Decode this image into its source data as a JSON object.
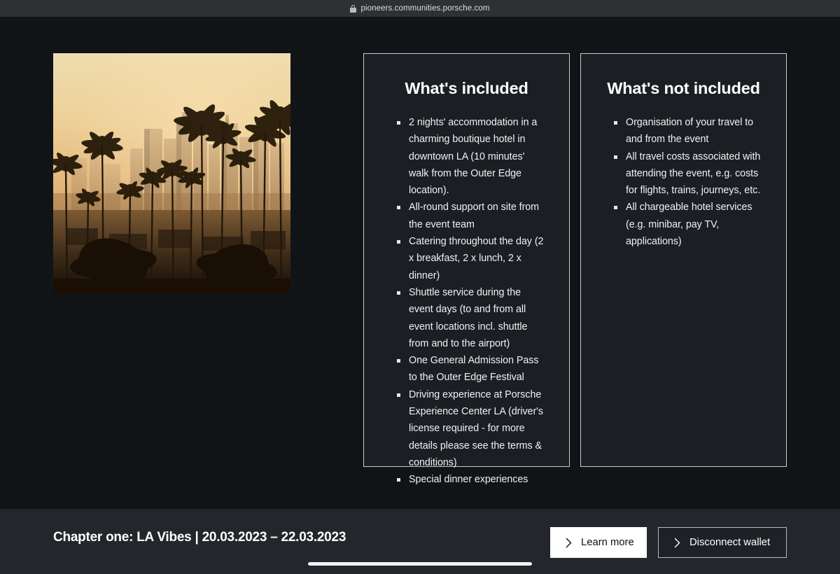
{
  "browser": {
    "url": "pioneers.communities.porsche.com",
    "lock_icon": "lock-icon",
    "tab_stub_glyph": "×"
  },
  "hero": {
    "alt": "Los Angeles downtown skyline at sunset framed by palm trees"
  },
  "panels": [
    {
      "id": "included",
      "title": "What's included",
      "items": [
        "2 nights' accommodation in a charming boutique hotel in downtown LA (10 minutes' walk from the Outer Edge location).",
        "All-round support on site from the event team",
        "Catering throughout the day (2 x breakfast, 2 x lunch, 2 x dinner)",
        "Shuttle service during the event days (to and from all event locations incl. shuttle from and to the airport)",
        "One General Admission Pass to the Outer Edge Festival",
        "Driving experience at Porsche Experience Center LA (driver's license required - for more details please see the terms & conditions)",
        "Special dinner experiences"
      ]
    },
    {
      "id": "not-included",
      "title": "What's not included",
      "items": [
        "Organisation of your travel to and from the event",
        "All travel costs associated with attending the event, e.g. costs for flights, trains, journeys, etc.",
        "All chargeable hotel services (e.g. minibar, pay TV, applications)"
      ]
    }
  ],
  "bottom_bar": {
    "chapter_title": "Chapter one: LA Vibes | 20.03.2023 – 22.03.2023",
    "learn_more_label": "Learn more",
    "disconnect_wallet_label": "Disconnect wallet",
    "chevron_icon": "chevron-right-icon"
  },
  "colors": {
    "page_background": "#111417",
    "panel_background": "#1b1f23",
    "panel_border": "#c8cacd",
    "bottom_bar_background": "#23272b",
    "primary_button_background": "#ffffff",
    "chrome_background": "#2e3033",
    "text_primary": "#ffffff"
  }
}
